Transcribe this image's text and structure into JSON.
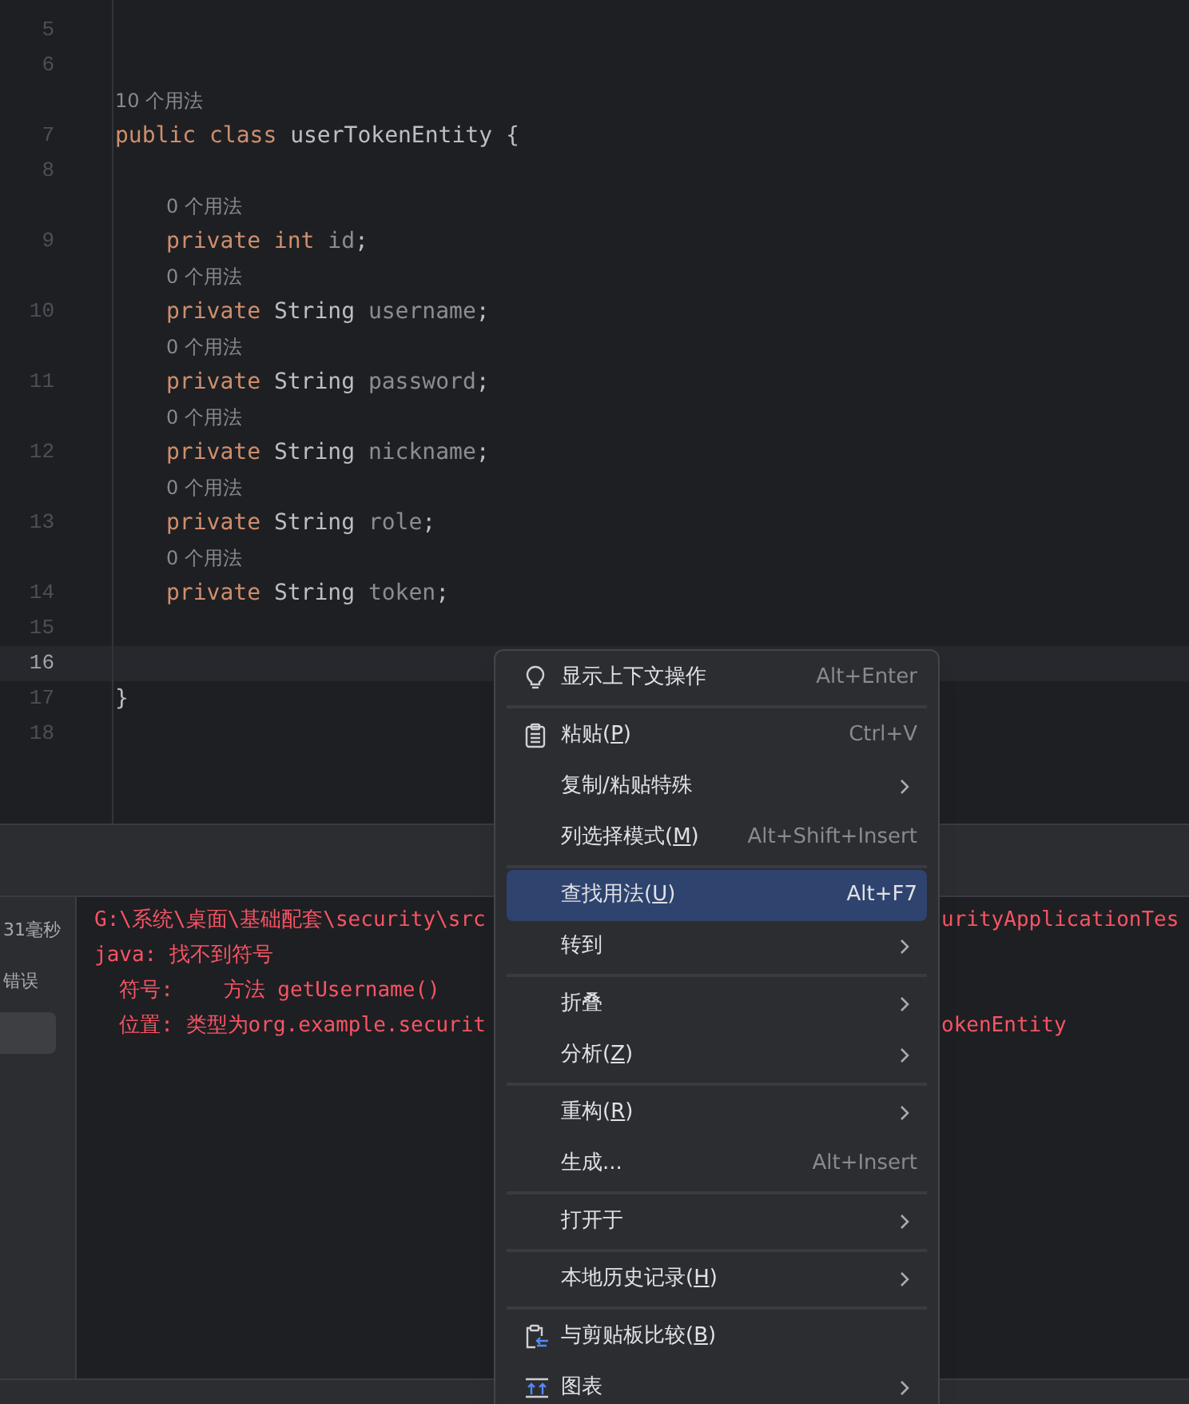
{
  "editor": {
    "lines": [
      {
        "number": "5"
      },
      {
        "number": "6"
      },
      {
        "number": "7",
        "hint": "10 个用法",
        "tokens": [
          {
            "kind": "keyword",
            "text": "public class "
          },
          {
            "kind": "plain",
            "text": "userTokenEntity {"
          }
        ],
        "children": [
          {
            "number": "8"
          },
          {
            "number": "9",
            "hint": "0 个用法",
            "tokens": [
              {
                "kind": "keyword",
                "text": "private int "
              },
              {
                "kind": "unused",
                "text": "id"
              },
              {
                "kind": "plain",
                "text": ";"
              }
            ]
          },
          {
            "number": "10",
            "hint": "0 个用法",
            "tokens": [
              {
                "kind": "keyword",
                "text": "private "
              },
              {
                "kind": "plain",
                "text": "String "
              },
              {
                "kind": "unused",
                "text": "username"
              },
              {
                "kind": "plain",
                "text": ";"
              }
            ]
          },
          {
            "number": "11",
            "hint": "0 个用法",
            "tokens": [
              {
                "kind": "keyword",
                "text": "private "
              },
              {
                "kind": "plain",
                "text": "String "
              },
              {
                "kind": "unused",
                "text": "password"
              },
              {
                "kind": "plain",
                "text": ";"
              }
            ]
          },
          {
            "number": "12",
            "hint": "0 个用法",
            "tokens": [
              {
                "kind": "keyword",
                "text": "private "
              },
              {
                "kind": "plain",
                "text": "String "
              },
              {
                "kind": "unused",
                "text": "nickname"
              },
              {
                "kind": "plain",
                "text": ";"
              }
            ]
          },
          {
            "number": "13",
            "hint": "0 个用法",
            "tokens": [
              {
                "kind": "keyword",
                "text": "private "
              },
              {
                "kind": "plain",
                "text": "String "
              },
              {
                "kind": "unused",
                "text": "role"
              },
              {
                "kind": "plain",
                "text": ";"
              }
            ]
          },
          {
            "number": "14",
            "hint": "0 个用法",
            "tokens": [
              {
                "kind": "keyword",
                "text": "private "
              },
              {
                "kind": "plain",
                "text": "String "
              },
              {
                "kind": "unused",
                "text": "token"
              },
              {
                "kind": "plain",
                "text": ";"
              }
            ]
          },
          {
            "number": "15"
          },
          {
            "number": "16",
            "current": true
          }
        ]
      },
      {
        "number": "17",
        "tokens": [
          {
            "kind": "plain",
            "text": "}"
          }
        ]
      },
      {
        "number": "18"
      }
    ]
  },
  "run_panel": {
    "items": [
      {
        "label": "31毫秒",
        "selected": false
      },
      {
        "label": "错误",
        "selected": false
      },
      {
        "selected": true
      }
    ],
    "console": [
      {
        "left": "G:\\系统\\桌面\\基础配套\\security\\src",
        "right": "urityApplicationTes"
      },
      {
        "left": "java: 找不到符号"
      },
      {
        "left": "  符号:    方法 getUsername()"
      },
      {
        "left": "  位置: 类型为org.example.securit",
        "right": "okenEntity"
      }
    ]
  },
  "context_menu": {
    "groups": [
      [
        {
          "kind": "bulb",
          "label": "显示上下文操作",
          "shortcut": "Alt+Enter",
          "submenu": false,
          "selected": false
        }
      ],
      [
        {
          "kind": "clipboard",
          "label": "粘贴(",
          "mnemonic": "P",
          "tail": ")",
          "shortcut": "Ctrl+V",
          "submenu": false,
          "selected": false
        },
        {
          "kind": "plain",
          "label": "复制/粘贴特殊",
          "submenu": true,
          "selected": false
        },
        {
          "kind": "plain",
          "label": "列选择模式(",
          "mnemonic": "M",
          "tail": ")",
          "shortcut": "Alt+Shift+Insert",
          "submenu": false,
          "selected": false
        }
      ],
      [
        {
          "kind": "plain",
          "label": "查找用法(",
          "mnemonic": "U",
          "tail": ")",
          "shortcut": "Alt+F7",
          "submenu": false,
          "selected": true
        },
        {
          "kind": "plain",
          "label": "转到",
          "submenu": true,
          "selected": false
        }
      ],
      [
        {
          "kind": "plain",
          "label": "折叠",
          "submenu": true,
          "selected": false
        },
        {
          "kind": "plain",
          "label": "分析(",
          "mnemonic": "Z",
          "tail": ")",
          "submenu": true,
          "selected": false
        }
      ],
      [
        {
          "kind": "plain",
          "label": "重构(",
          "mnemonic": "R",
          "tail": ")",
          "submenu": true,
          "selected": false
        },
        {
          "kind": "plain",
          "label": "生成...",
          "shortcut": "Alt+Insert",
          "submenu": false,
          "selected": false
        }
      ],
      [
        {
          "kind": "plain",
          "label": "打开于",
          "submenu": true,
          "selected": false
        }
      ],
      [
        {
          "kind": "plain",
          "label": "本地历史记录(",
          "mnemonic": "H",
          "tail": ")",
          "submenu": true,
          "selected": false
        }
      ],
      [
        {
          "kind": "compare",
          "label": "与剪贴板比较(",
          "mnemonic": "B",
          "tail": ")",
          "submenu": false,
          "selected": false
        },
        {
          "kind": "chart",
          "label": "图表",
          "submenu": true,
          "selected": false
        }
      ]
    ]
  }
}
